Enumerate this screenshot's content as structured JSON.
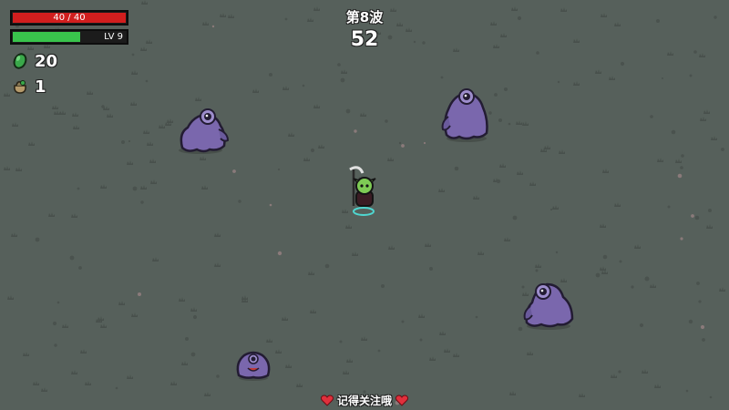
{
  "hud": {
    "hp_text": "40 / 40",
    "hp_fraction": 1.0,
    "level_text": "LV 9",
    "xp_fraction": 0.6,
    "materials_count": "20",
    "bag_count": "1"
  },
  "wave": {
    "title": "第8波",
    "timer": "52"
  },
  "footer": {
    "text": "记得关注哦"
  },
  "icons": [
    "heart-icon",
    "material-icon",
    "bag-icon"
  ],
  "colors": {
    "ground": "#56605b",
    "hp": "#d11e1e",
    "xp": "#39c44c",
    "enemy": "#7a67ad"
  }
}
